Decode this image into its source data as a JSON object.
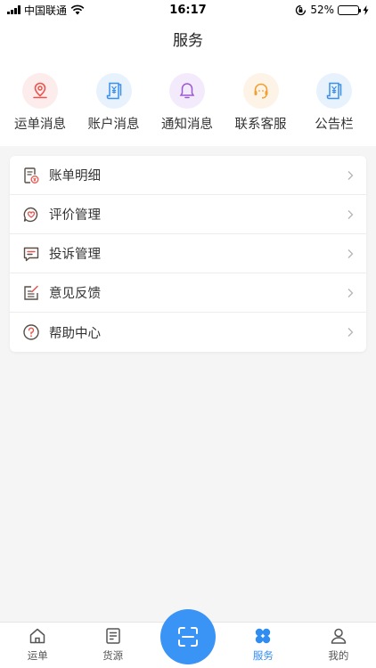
{
  "status_bar": {
    "carrier": "中国联通",
    "time": "16:17",
    "battery_percent": "52%",
    "battery_level": 0.52
  },
  "header": {
    "title": "服务"
  },
  "quick_actions": [
    {
      "label": "运单消息",
      "icon": "location-pin-icon",
      "color": "#e8554e",
      "bg": "#fdecec"
    },
    {
      "label": "账户消息",
      "icon": "yuan-receipt-icon",
      "color": "#3a8fe8",
      "bg": "#e8f2fd"
    },
    {
      "label": "通知消息",
      "icon": "bell-icon",
      "color": "#9b59d6",
      "bg": "#f3ebfb"
    },
    {
      "label": "联系客服",
      "icon": "headset-icon",
      "color": "#f0a030",
      "bg": "#fdf3e6"
    },
    {
      "label": "公告栏",
      "icon": "yuan-receipt-icon",
      "color": "#3a8fe8",
      "bg": "#e8f2fd"
    }
  ],
  "menu": [
    {
      "label": "账单明细",
      "icon": "bill-detail-icon"
    },
    {
      "label": "评价管理",
      "icon": "heart-chat-icon"
    },
    {
      "label": "投诉管理",
      "icon": "complaint-chat-icon"
    },
    {
      "label": "意见反馈",
      "icon": "feedback-edit-icon"
    },
    {
      "label": "帮助中心",
      "icon": "help-question-icon"
    }
  ],
  "tabs": [
    {
      "label": "运单",
      "icon": "home-icon"
    },
    {
      "label": "货源",
      "icon": "document-icon"
    },
    {
      "label": "",
      "icon": "scan-icon"
    },
    {
      "label": "服务",
      "icon": "grid-icon"
    },
    {
      "label": "我的",
      "icon": "user-icon"
    }
  ],
  "colors": {
    "accent": "#3a94f6",
    "active_tab": "#2f8cf0",
    "menu_icon": "#5a4f47",
    "menu_icon_accent": "#e8554e"
  }
}
